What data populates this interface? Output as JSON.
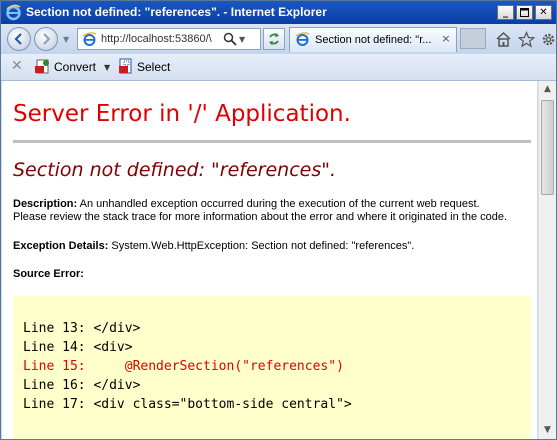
{
  "window": {
    "title": "Section not defined: \"references\". - Internet Explorer",
    "min_icon": "minimize-icon",
    "max_icon": "maximize-icon",
    "close_icon": "close-icon"
  },
  "nav": {
    "address": "http://localhost:53860/\\",
    "tab_title": "Section not defined: \"r...",
    "tab_close": "×",
    "icons": [
      "back-icon",
      "forward-icon",
      "ie-page-icon",
      "search-icon",
      "refresh-icon",
      "home-icon",
      "favorites-star-icon",
      "gear-icon"
    ]
  },
  "command_bar": {
    "close": "✕",
    "convert_label": "Convert",
    "select_label": "Select"
  },
  "page": {
    "heading": "Server Error in '/' Application.",
    "subheading": "Section not defined: \"references\".",
    "description_label": "Description:",
    "description_line1": "An unhandled exception occurred during the execution of the current web request.",
    "description_line2": "Please review the stack trace for more information about the error and where it originated in the code.",
    "exception_label": "Exception Details:",
    "exception_text": "System.Web.HttpException: Section not defined: \"references\".",
    "source_error_label": "Source Error:",
    "code_lines": [
      "Line 13: </div>",
      "Line 14: <div>",
      "Line 15:     @RenderSection(\"references\")",
      "Line 16: </div>",
      "Line 17: <div class=\"bottom-side central\">"
    ]
  },
  "colors": {
    "heading": "#e00000",
    "subheading": "#800000",
    "error_line": "#e00000",
    "code_bg": "#ffffcc",
    "titlebar": "#0b3ea6"
  }
}
